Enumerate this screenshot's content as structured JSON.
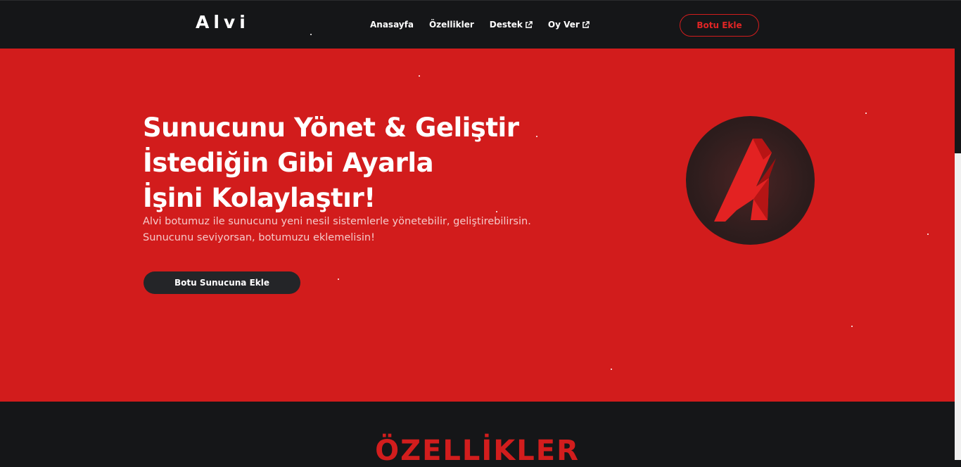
{
  "nav": {
    "brand": "Alvi",
    "links": [
      {
        "label": "Anasayfa",
        "external": false
      },
      {
        "label": "Özellikler",
        "external": false
      },
      {
        "label": "Destek",
        "external": true
      },
      {
        "label": "Oy Ver",
        "external": true
      }
    ],
    "add_button": "Botu Ekle"
  },
  "hero": {
    "headline_lines": [
      "Sunucunu Yönet & Geliştir",
      "İstediğin Gibi Ayarla",
      "İşini Kolaylaştır!"
    ],
    "subtext_lines": [
      "Alvi botumuz ile sunucunu yeni nesil sistemlerle yönetebilir, geliştirebilirsin.",
      "Sunucunu seviyorsan, botumuzu eklemelisin!"
    ],
    "cta_button": "Botu Sunucuna Ekle",
    "logo_icon": "alvi-a-logo-icon"
  },
  "features": {
    "title": "ÖZELLİKLER"
  },
  "colors": {
    "accent": "#d21c1c",
    "dark": "#151618",
    "button_dark": "#242528"
  }
}
